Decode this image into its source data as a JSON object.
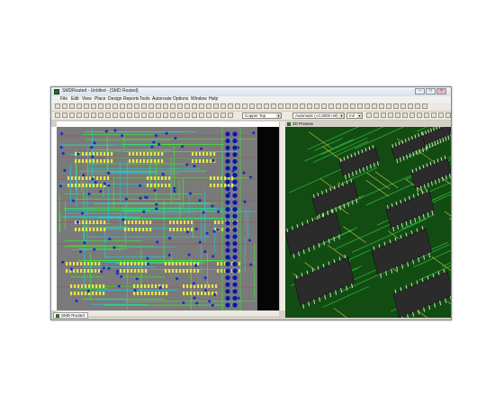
{
  "window": {
    "title": "SMDRouted - Untitled - [SMD Routed]",
    "controls": [
      "–",
      "□",
      "×"
    ]
  },
  "menu": [
    "File",
    "Edit",
    "View",
    "Place",
    "Design",
    "Reports",
    "Tools",
    "Autoroute",
    "Options",
    "Window",
    "Help"
  ],
  "toolbar": {
    "layer_select": "Copper Top",
    "route_mode": "Automatic (=0.3000 mil)",
    "units_select": "mil"
  },
  "tabs": {
    "document_tab": "SMD Routed"
  },
  "preview": {
    "title": "3D Preview"
  },
  "colors": {
    "board_gray": "#7a7a7a",
    "trace_green": "#3ee83e",
    "trace_cyan": "#22c7d9",
    "via_blue": "#1d2aa8",
    "pad_yellow": "#e6e64a",
    "board_3d_green": "#134c12",
    "chip_dark": "#2b2b2b"
  }
}
